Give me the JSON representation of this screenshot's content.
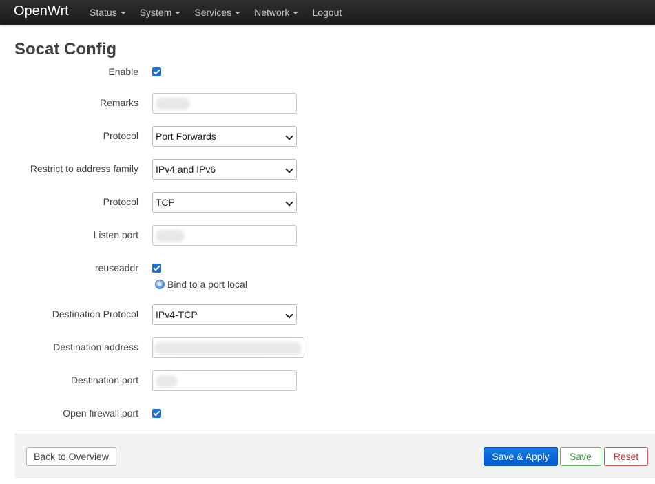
{
  "navbar": {
    "brand": "OpenWrt",
    "menu": [
      {
        "label": "Status",
        "dropdown": true
      },
      {
        "label": "System",
        "dropdown": true
      },
      {
        "label": "Services",
        "dropdown": true
      },
      {
        "label": "Network",
        "dropdown": true
      },
      {
        "label": "Logout",
        "dropdown": false
      }
    ]
  },
  "page": {
    "title": "Socat Config"
  },
  "form": {
    "enable": {
      "label": "Enable",
      "checked": true
    },
    "remarks": {
      "label": "Remarks",
      "value": ""
    },
    "protocol": {
      "label": "Protocol",
      "value": "Port Forwards"
    },
    "address_family": {
      "label": "Restrict to address family",
      "value": "IPv4 and IPv6"
    },
    "transport": {
      "label": "Protocol",
      "value": "TCP"
    },
    "listen_port": {
      "label": "Listen port",
      "value": ""
    },
    "reuseaddr": {
      "label": "reuseaddr",
      "checked": true,
      "hint": "Bind to a port local"
    },
    "dest_protocol": {
      "label": "Destination Protocol",
      "value": "IPv4-TCP"
    },
    "dest_address": {
      "label": "Destination address",
      "value": ""
    },
    "dest_port": {
      "label": "Destination port",
      "value": ""
    },
    "firewall": {
      "label": "Open firewall port",
      "checked": true
    }
  },
  "actions": {
    "back": "Back to Overview",
    "save_apply": "Save & Apply",
    "save": "Save",
    "reset": "Reset"
  },
  "icons": {
    "checkbox": "checkbox-checked-icon",
    "info": "info-icon",
    "dropdown": "chevron-down-icon"
  },
  "colors": {
    "navbar_bg": "#232323",
    "accent": "#0069e0",
    "save_green": "#5cb85c",
    "reset_red": "#d9534f"
  }
}
